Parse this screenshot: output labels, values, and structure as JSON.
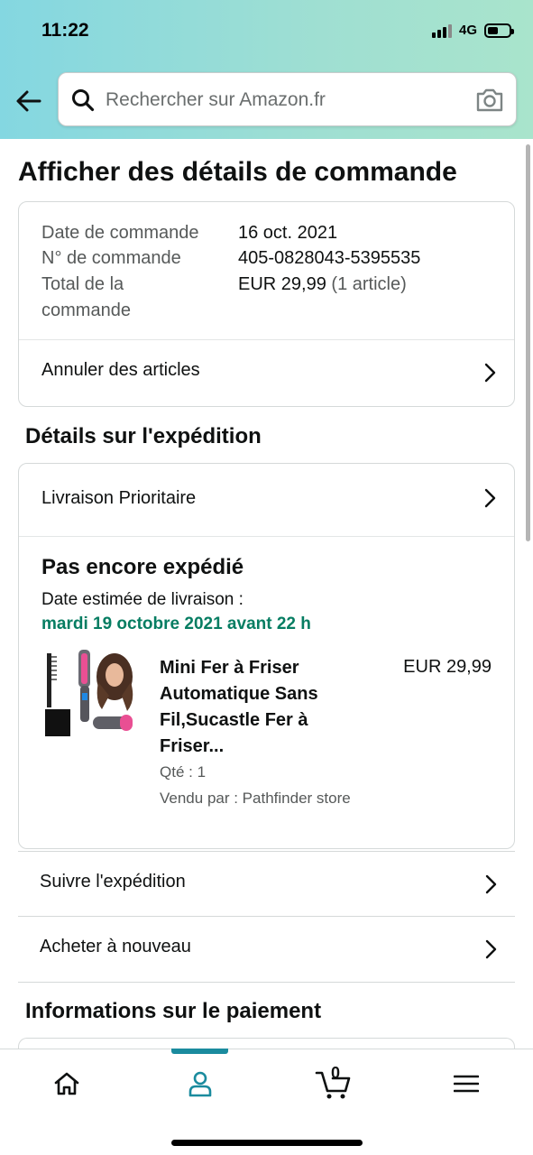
{
  "status_bar": {
    "time": "11:22",
    "network": "4G"
  },
  "header": {
    "search_placeholder": "Rechercher sur Amazon.fr"
  },
  "page_title": "Afficher des détails de commande",
  "order_summary": {
    "date_label": "Date de commande",
    "date_value": "16 oct. 2021",
    "number_label": "N° de commande",
    "number_value": "405-0828043-5395535",
    "total_label_line1": "Total de la",
    "total_label_line2": "commande",
    "total_value": "EUR 29,99",
    "total_items": "(1 article)",
    "cancel_label": "Annuler des articles"
  },
  "shipping": {
    "section_title": "Détails sur l'expédition",
    "delivery_option": "Livraison Prioritaire",
    "status": "Pas encore expédié",
    "estimate_label": "Date estimée de livraison :",
    "estimate_date": "mardi 19 octobre 2021 avant 22 h",
    "product": {
      "title": "Mini Fer à Friser Automatique Sans Fil,Sucastle Fer à Friser...",
      "price": "EUR 29,99",
      "quantity": "Qté : 1",
      "seller": "Vendu par : Pathfinder store"
    }
  },
  "actions": {
    "track": "Suivre l'expédition",
    "buy_again": "Acheter à nouveau"
  },
  "payment": {
    "section_title": "Informations sur le paiement"
  },
  "bottom_nav": {
    "cart_count": "0"
  },
  "colors": {
    "accent": "#1a8b9e",
    "green": "#067d62",
    "header_start": "#84d7e1",
    "header_end": "#a9e4cc"
  }
}
